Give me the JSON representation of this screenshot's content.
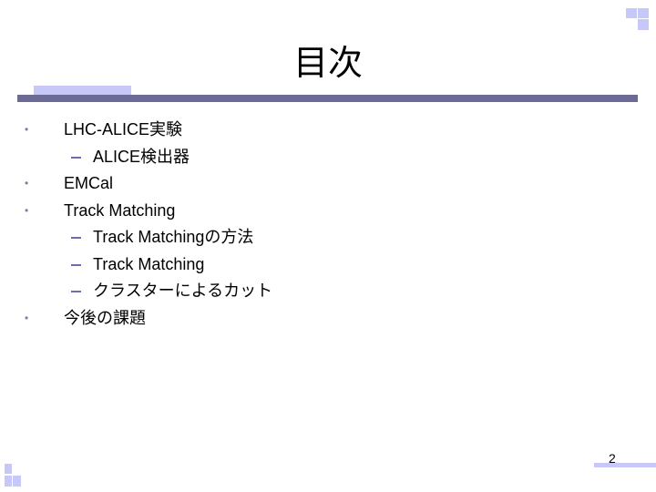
{
  "slide": {
    "title": "目次",
    "page_number": "2",
    "accent_color": "#c8c8f8",
    "rule_color": "#6b6b96",
    "bullet_color": "#7d7d9c",
    "dash_color": "#6d6dab"
  },
  "outline": [
    {
      "level": 1,
      "marker": "•",
      "text": "LHC-ALICE実験"
    },
    {
      "level": 2,
      "marker": "–",
      "text": "ALICE検出器"
    },
    {
      "level": 1,
      "marker": "•",
      "text": "EMCal"
    },
    {
      "level": 1,
      "marker": "•",
      "text": "Track Matching"
    },
    {
      "level": 2,
      "marker": "–",
      "text": "Track Matchingの方法"
    },
    {
      "level": 2,
      "marker": "–",
      "text": "Track Matching"
    },
    {
      "level": 2,
      "marker": "–",
      "text": "クラスターによるカット"
    },
    {
      "level": 1,
      "marker": "•",
      "text": "今後の課題"
    }
  ]
}
